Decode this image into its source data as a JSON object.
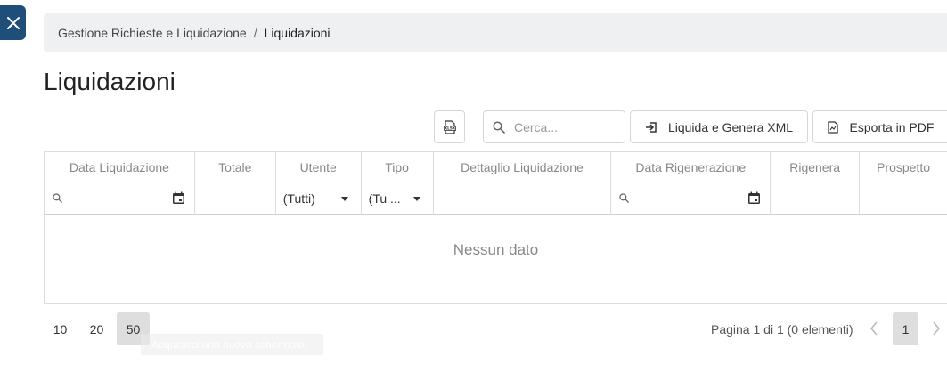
{
  "breadcrumb": {
    "parent": "Gestione Richieste e Liquidazione",
    "separator": "/",
    "current": "Liquidazioni"
  },
  "page_title": "Liquidazioni",
  "toolbar": {
    "xlsx_icon_text": "XLSX",
    "search_placeholder": "Cerca...",
    "liquida_label": "Liquida e Genera XML",
    "esporta_label": "Esporta in PDF"
  },
  "grid": {
    "columns": [
      "Data Liquidazione",
      "Totale",
      "Utente",
      "Tipo",
      "Dettaglio Liquidazione",
      "Data Rigenerazione",
      "Rigenera",
      "Prospetto"
    ],
    "filters": {
      "utente_value": "(Tutti)",
      "tipo_value": "(Tu ..."
    },
    "no_data": "Nessun dato"
  },
  "pager": {
    "sizes": [
      "10",
      "20",
      "50"
    ],
    "active_size": "50",
    "info": "Pagina 1 di 1 (0 elementi)",
    "current_page": "1"
  },
  "tooltip": "Acquisisci una nuova schermata",
  "colors": {
    "accent": "#1f4e79",
    "breadcrumb_bg": "#eef0f2",
    "active_bg": "#dedede"
  }
}
